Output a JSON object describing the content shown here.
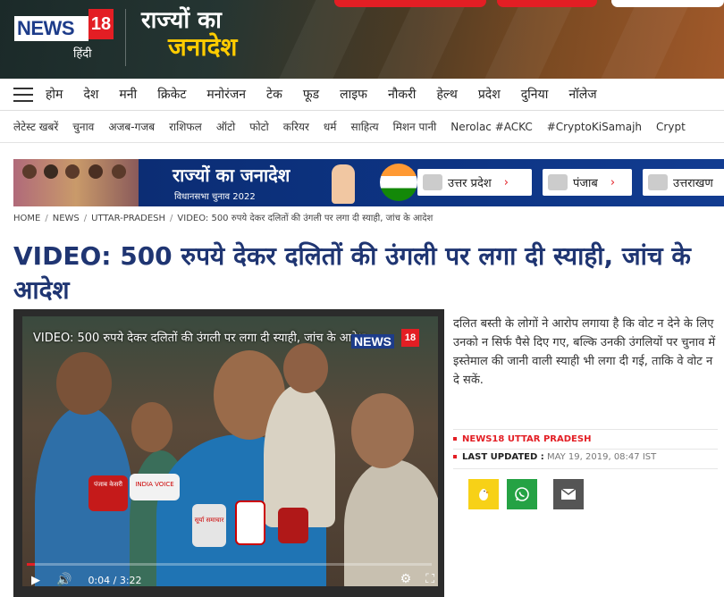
{
  "header": {
    "logo_text": "NEWS",
    "logo_number": "18",
    "logo_sub": "हिंदी",
    "campaign_line1": "राज्यों का",
    "campaign_line2": "जनादेश"
  },
  "nav_primary": [
    "होम",
    "देश",
    "मनी",
    "क्रिकेट",
    "मनोरंजन",
    "टेक",
    "फूड",
    "लाइफ",
    "नौकरी",
    "हेल्थ",
    "प्रदेश",
    "दुनिया",
    "नॉलेज"
  ],
  "nav_secondary": [
    "लेटेस्ट खबरें",
    "चुनाव",
    "अजब-गजब",
    "राशिफल",
    "ऑटो",
    "फोटो",
    "करियर",
    "धर्म",
    "साहित्य",
    "मिशन पानी",
    "Nerolac #ACKC",
    "#CryptoKiSamajh",
    "Crypt"
  ],
  "banner": {
    "title": "राज्यों का जनादेश",
    "subtitle": "विधानसभा चुनाव 2022",
    "states": [
      "उत्तर प्रदेश",
      "पंजाब",
      "उत्तराखण"
    ]
  },
  "breadcrumb": [
    "HOME",
    "NEWS",
    "UTTAR-PRADESH",
    "VIDEO: 500 रुपये देकर दलितों की उंगली पर लगा दी स्याही, जांच के आदेश"
  ],
  "article": {
    "headline": "VIDEO: 500 रुपये देकर दलितों की उंगली पर लगा दी स्याही, जांच के आदेश",
    "description": "दलित बस्ती के लोगों ने आरोप लगाया है कि वोट न देने के लिए उनको न सिर्फ पैसे दिए गए, बल्कि उनकी उंगलियों पर चुनाव में इस्तेमाल की जानी वाली स्याही भी लगा दी गई, ताकि वे वोट न दे सकें.",
    "source": "NEWS18 UTTAR PRADESH",
    "updated_label": "LAST UPDATED :",
    "updated_value": "MAY 19, 2019, 08:47 IST"
  },
  "video": {
    "title": "VIDEO: 500 रुपये देकर दलितों की उंगली पर लगा दी स्याही, जांच के आदेश",
    "current_time": "0:04",
    "duration": "3:22",
    "time_display": "0:04 / 3:22",
    "progress_fraction": 0.02,
    "mic_labels": [
      "पंजाब केसरी",
      "INDIA VOICE",
      "सूर्या समाचार",
      "",
      ""
    ]
  },
  "share_icons": [
    "koo-icon",
    "whatsapp-icon",
    "mail-icon"
  ],
  "colors": {
    "accent": "#e31e24",
    "headline": "#1f3572",
    "koo": "#f7d117",
    "whatsapp": "#25a244",
    "mail": "#555555"
  }
}
